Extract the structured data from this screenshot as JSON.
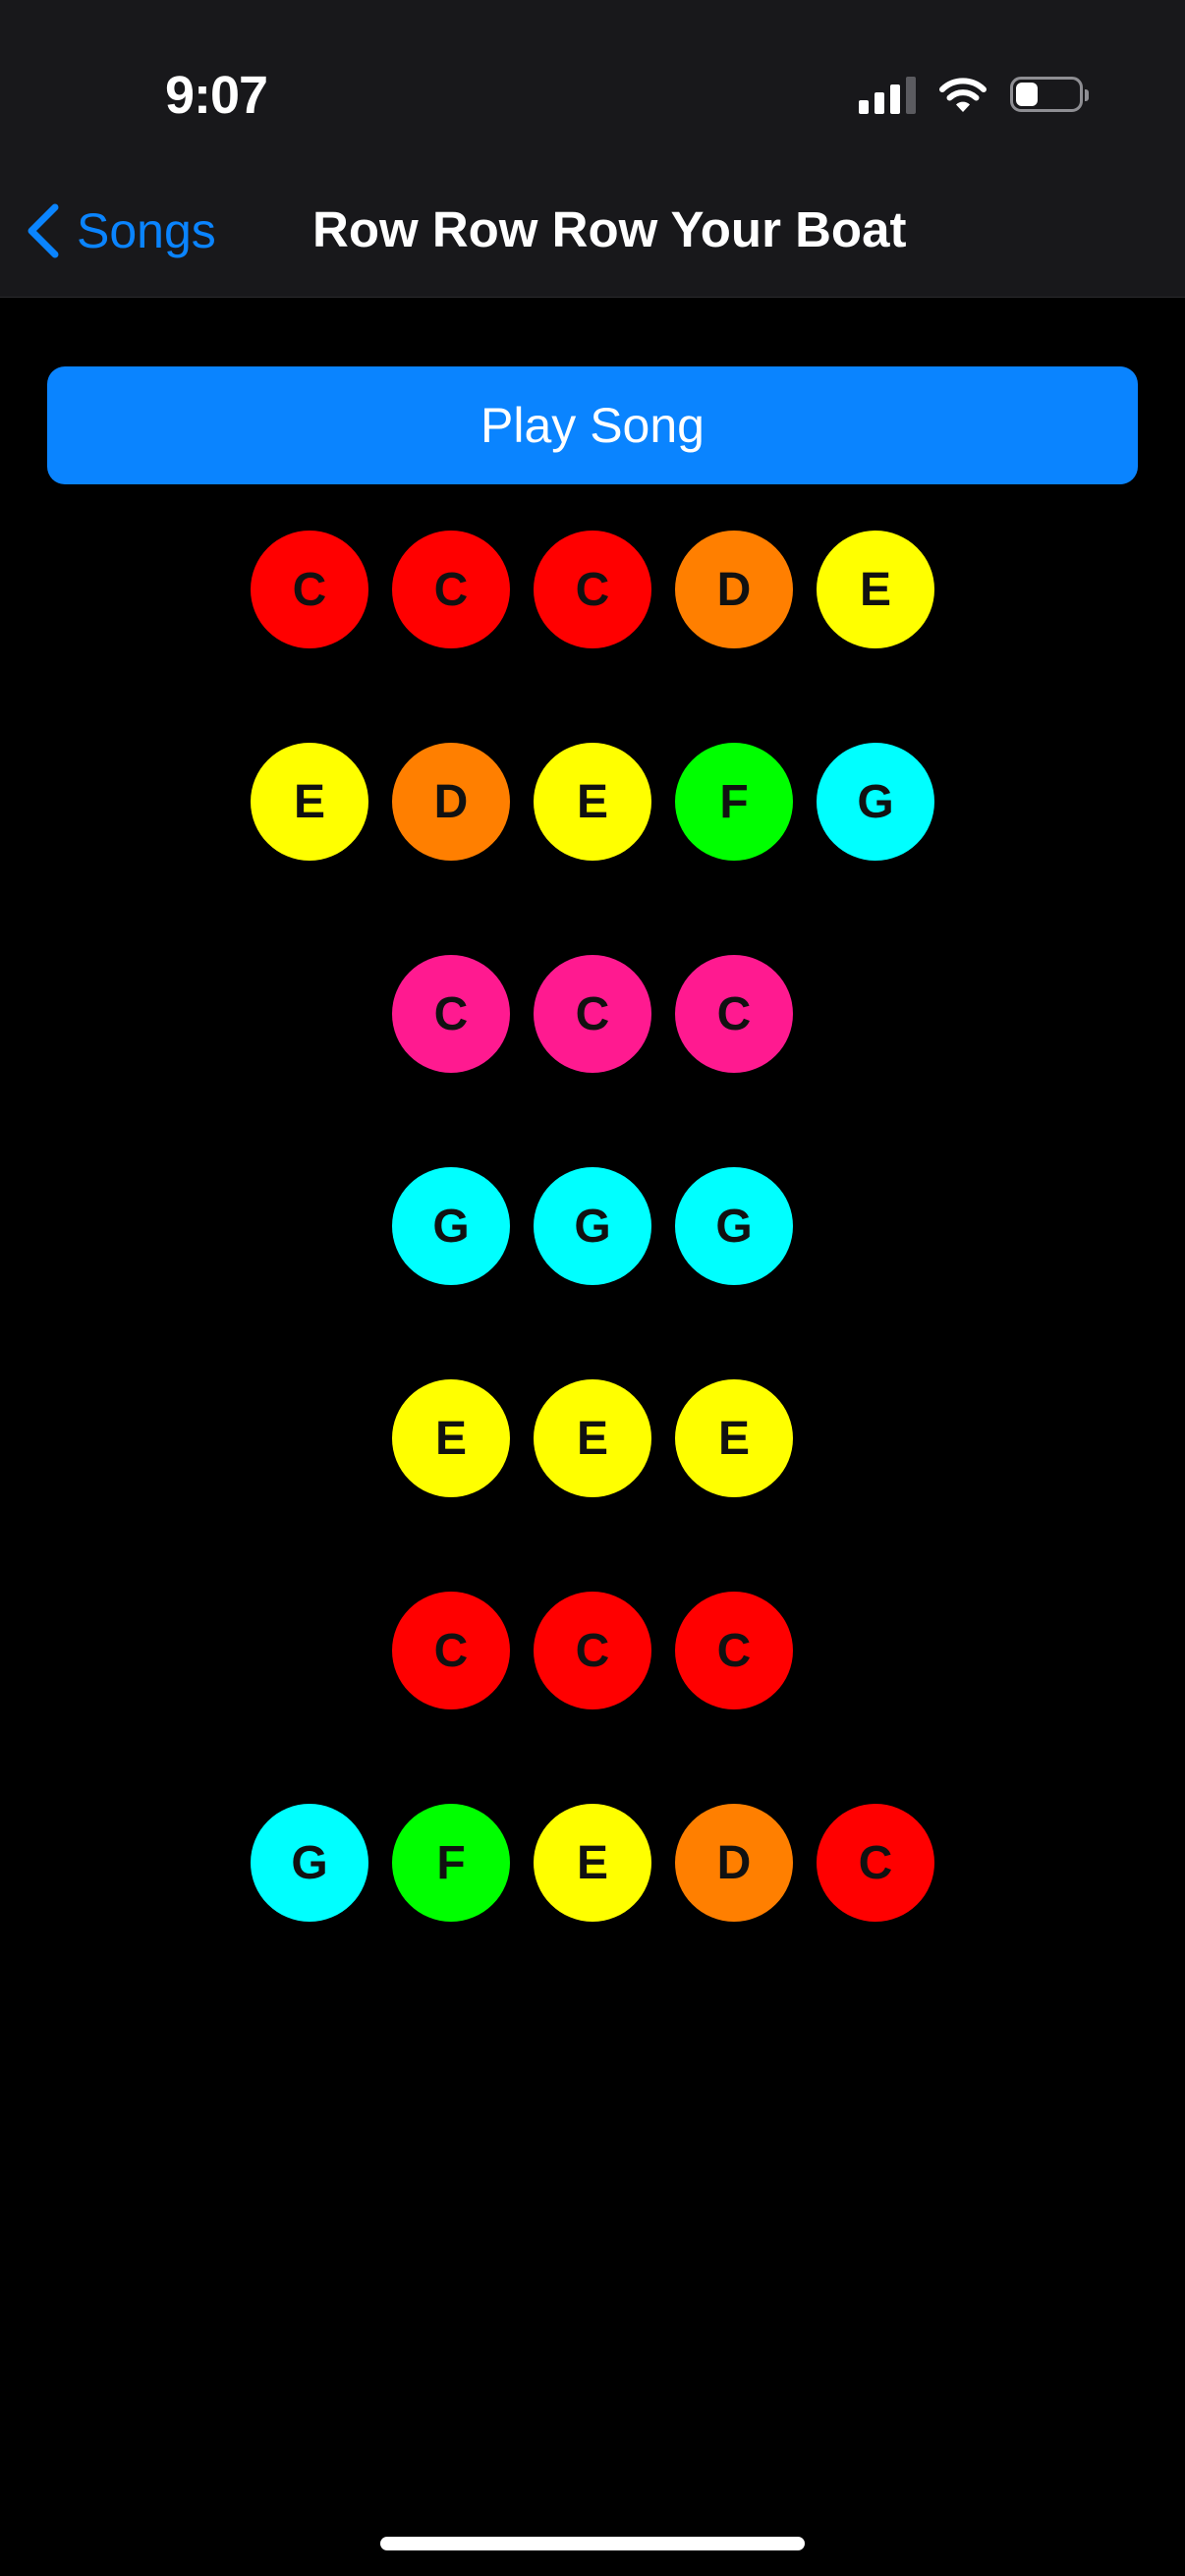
{
  "status_bar": {
    "time": "9:07",
    "signal_icon": "cellular-signal-icon",
    "wifi_icon": "wifi-icon",
    "battery_icon": "battery-icon",
    "battery_level": 0.35
  },
  "nav": {
    "back_icon": "chevron-left-icon",
    "back_label": "Songs",
    "title": "Row Row Row Your Boat"
  },
  "play_button": {
    "label": "Play Song"
  },
  "note_colors": {
    "C_red": "#ff0000",
    "C_pink": "#ff1a90",
    "D": "#ff7f00",
    "E": "#ffff00",
    "F": "#00ff00",
    "G": "#00ffff"
  },
  "rows": [
    [
      {
        "note": "C",
        "color": "#ff0000"
      },
      {
        "note": "C",
        "color": "#ff0000"
      },
      {
        "note": "C",
        "color": "#ff0000"
      },
      {
        "note": "D",
        "color": "#ff7f00"
      },
      {
        "note": "E",
        "color": "#ffff00"
      }
    ],
    [
      {
        "note": "E",
        "color": "#ffff00"
      },
      {
        "note": "D",
        "color": "#ff7f00"
      },
      {
        "note": "E",
        "color": "#ffff00"
      },
      {
        "note": "F",
        "color": "#00ff00"
      },
      {
        "note": "G",
        "color": "#00ffff"
      }
    ],
    [
      {
        "note": "C",
        "color": "#ff1a90"
      },
      {
        "note": "C",
        "color": "#ff1a90"
      },
      {
        "note": "C",
        "color": "#ff1a90"
      }
    ],
    [
      {
        "note": "G",
        "color": "#00ffff"
      },
      {
        "note": "G",
        "color": "#00ffff"
      },
      {
        "note": "G",
        "color": "#00ffff"
      }
    ],
    [
      {
        "note": "E",
        "color": "#ffff00"
      },
      {
        "note": "E",
        "color": "#ffff00"
      },
      {
        "note": "E",
        "color": "#ffff00"
      }
    ],
    [
      {
        "note": "C",
        "color": "#ff0000"
      },
      {
        "note": "C",
        "color": "#ff0000"
      },
      {
        "note": "C",
        "color": "#ff0000"
      }
    ],
    [
      {
        "note": "G",
        "color": "#00ffff"
      },
      {
        "note": "F",
        "color": "#00ff00"
      },
      {
        "note": "E",
        "color": "#ffff00"
      },
      {
        "note": "D",
        "color": "#ff7f00"
      },
      {
        "note": "C",
        "color": "#ff0000"
      }
    ]
  ]
}
